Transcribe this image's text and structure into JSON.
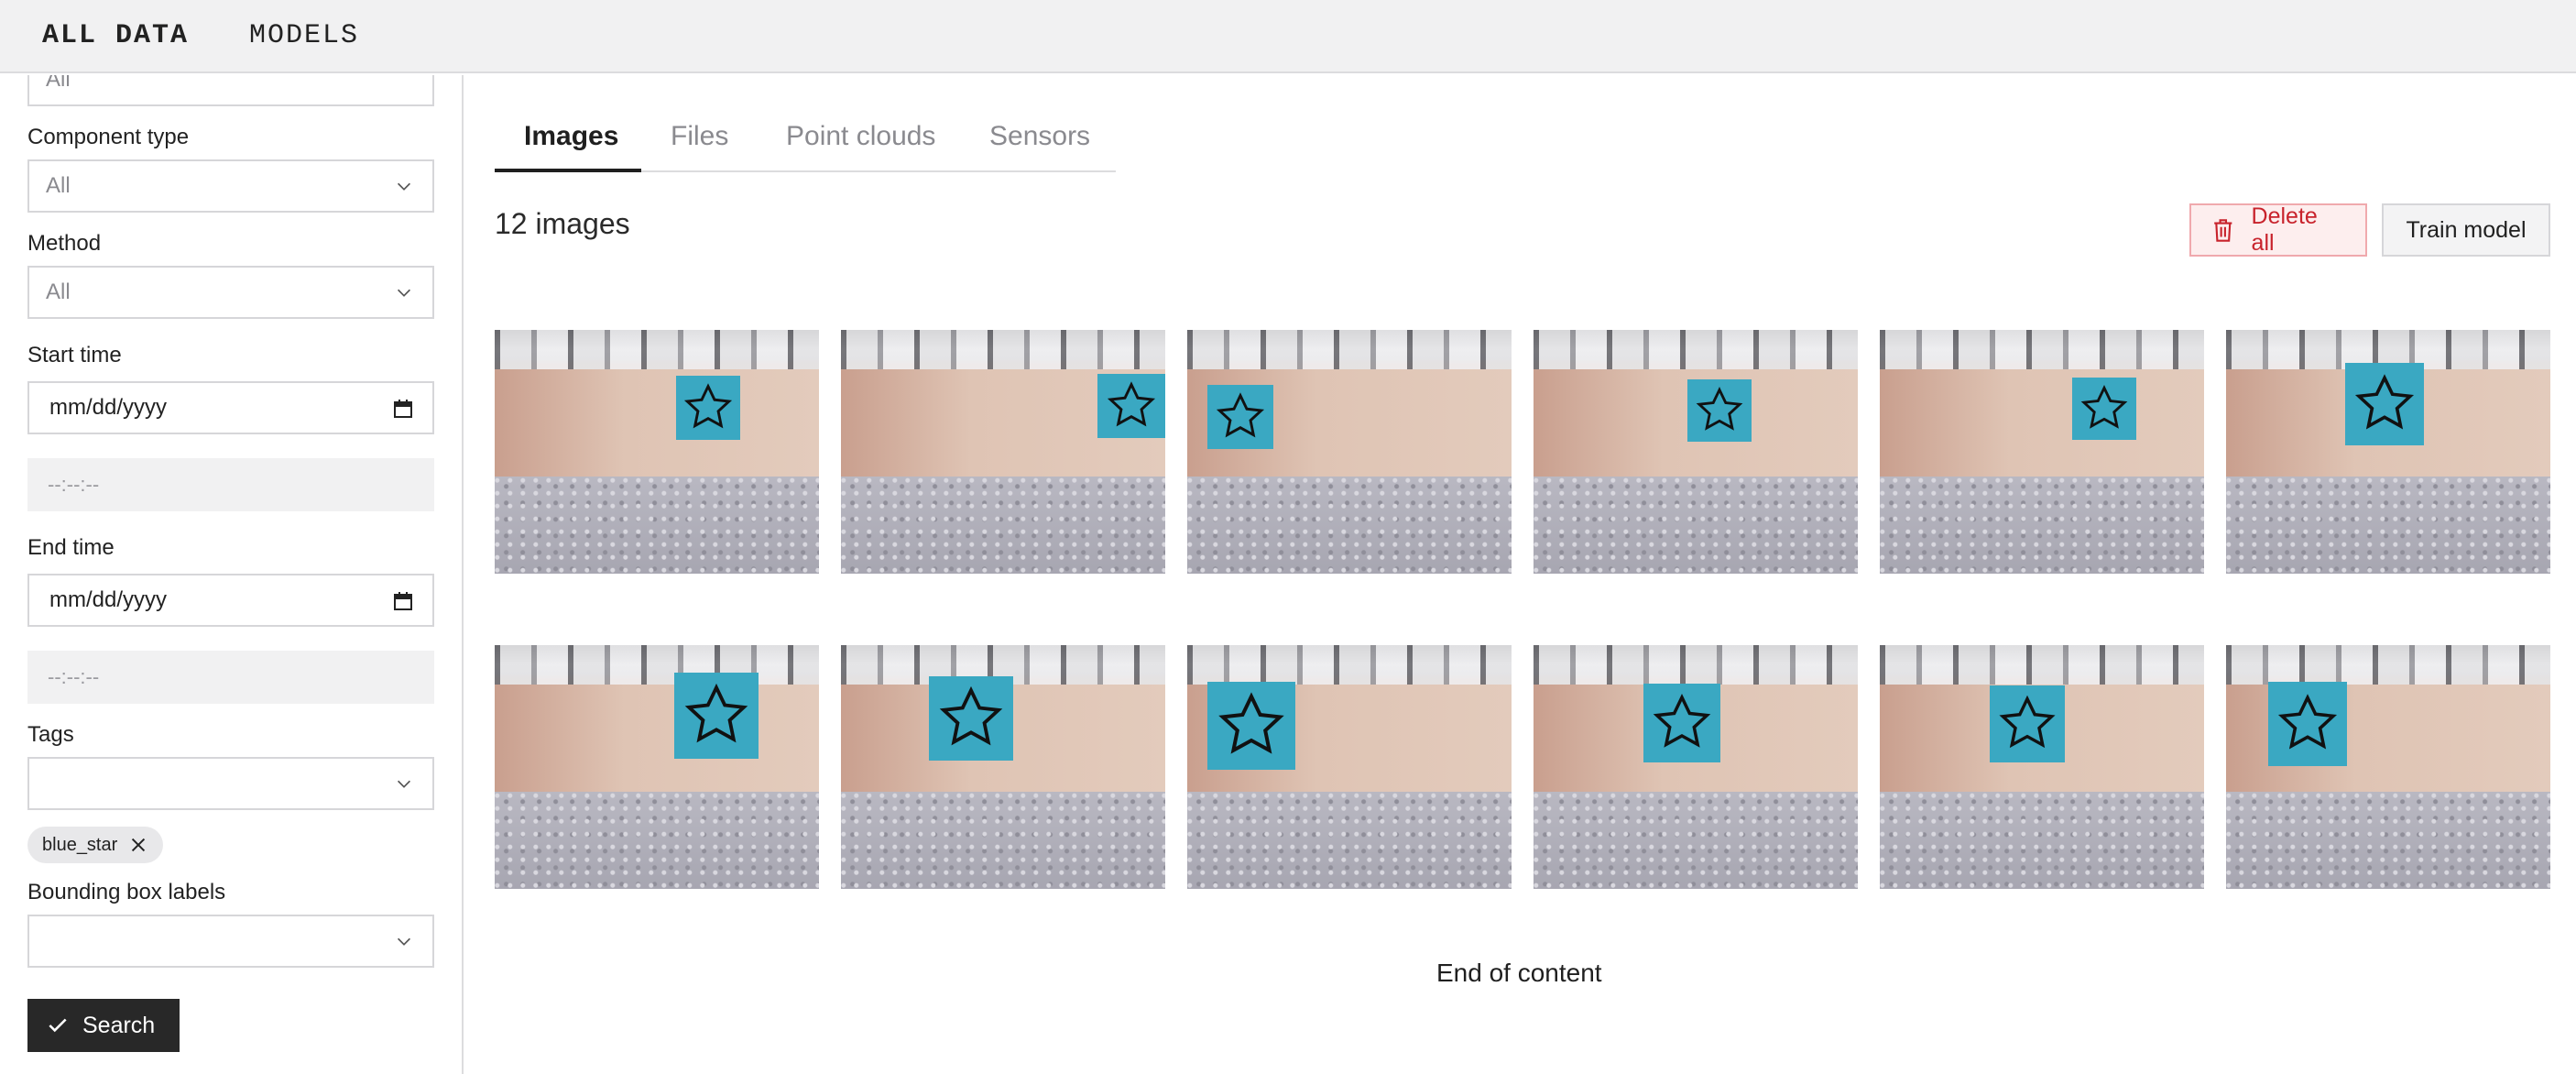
{
  "topnav": {
    "all_data": "ALL DATA",
    "models": "MODELS"
  },
  "filters": {
    "partial_select_value": "All",
    "component_type": {
      "label": "Component type",
      "value": "All"
    },
    "method": {
      "label": "Method",
      "value": "All"
    },
    "start_time": {
      "label": "Start time",
      "date": "mm/dd/yyyy",
      "time": "--:--:--"
    },
    "end_time": {
      "label": "End time",
      "date": "mm/dd/yyyy",
      "time": "--:--:--"
    },
    "tags": {
      "label": "Tags",
      "value": "",
      "chip": "blue_star"
    },
    "bounding_box_labels": {
      "label": "Bounding box labels",
      "value": ""
    },
    "search_button": "Search"
  },
  "tabs": [
    "Images",
    "Files",
    "Point clouds",
    "Sensors"
  ],
  "active_tab": "Images",
  "results": {
    "count_text": "12 images",
    "end_text": "End of content"
  },
  "actions": {
    "delete_all": "Delete all",
    "train_model": "Train model"
  },
  "colors": {
    "accent_delete": "#c8232c",
    "sign_blue": "#3aa8c2",
    "dark_button": "#282828"
  },
  "icons": [
    "chevron-down-icon",
    "calendar-icon",
    "close-icon",
    "check-icon",
    "trash-icon",
    "star-icon"
  ]
}
